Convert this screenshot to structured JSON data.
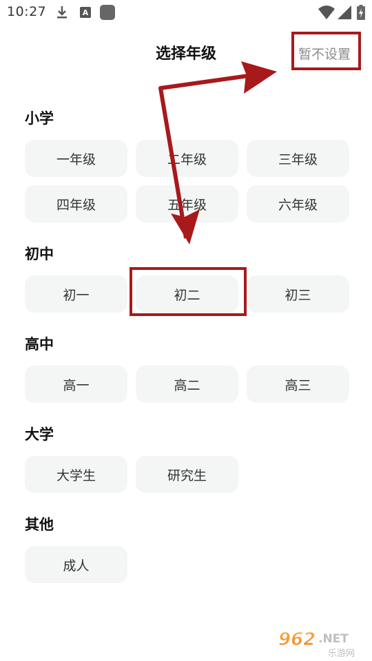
{
  "status_bar": {
    "time": "10:27",
    "icons": [
      "download-icon",
      "a-icon",
      "square-icon",
      "wifi-icon",
      "signal-icon",
      "battery-icon"
    ]
  },
  "header": {
    "title": "选择年级",
    "skip_label": "暂不设置"
  },
  "sections": {
    "primary": {
      "title": "小学",
      "grades": [
        "一年级",
        "二年级",
        "三年级",
        "四年级",
        "五年级",
        "六年级"
      ]
    },
    "junior": {
      "title": "初中",
      "grades": [
        "初一",
        "初二",
        "初三"
      ]
    },
    "senior": {
      "title": "高中",
      "grades": [
        "高一",
        "高二",
        "高三"
      ]
    },
    "university": {
      "title": "大学",
      "grades": [
        "大学生",
        "研究生"
      ]
    },
    "other": {
      "title": "其他",
      "grades": [
        "成人"
      ]
    }
  },
  "annotation": {
    "color": "#a8191b",
    "highlighted": [
      "暂不设置",
      "初二"
    ]
  },
  "watermark": {
    "text": "962.NET",
    "subtext": "乐游网"
  },
  "colors": {
    "button_bg": "#f4f5f5",
    "skip_text": "#8a8a8a",
    "annotation_red": "#a8191b"
  }
}
